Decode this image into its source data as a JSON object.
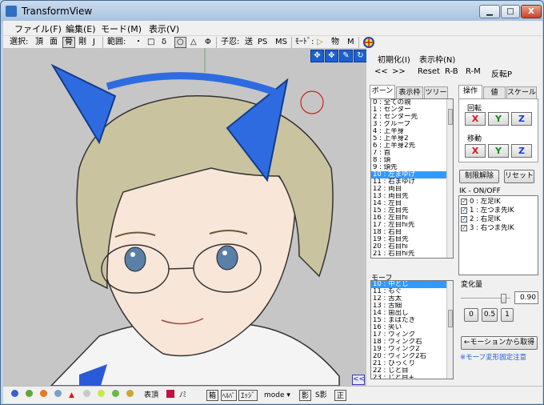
{
  "window": {
    "title": "TransformView",
    "min_label": "▁",
    "max_label": "□",
    "close_label": "X"
  },
  "menu": {
    "items": [
      "ファイル(F)",
      "編集(E)",
      "モード(M)",
      "表示(V)"
    ]
  },
  "toolbar": {
    "select_label": "選択:",
    "select_items": [
      "頂",
      "面",
      "骨",
      "剛",
      "J"
    ],
    "range_label": "範囲:",
    "range_items": [
      "・",
      "□",
      "δ",
      "○",
      "△",
      "Φ"
    ],
    "mode_label": "子忍:",
    "mode_items": [
      "送",
      "PS",
      "MS"
    ],
    "mode2_label": "ﾓｰﾄﾞ:",
    "play_icon": "▷",
    "physics_label": "物",
    "m_label": "M"
  },
  "viewport": {
    "tool_icons": [
      "move-icon",
      "move-icon",
      "pen-icon",
      "rotate-icon"
    ],
    "collapse_label": "<<"
  },
  "panel": {
    "top_links": [
      "初期化(I)",
      "表示枠(N)"
    ],
    "nav": [
      "<<",
      ">>",
      "Reset",
      "R-B",
      "R-M",
      "反転P"
    ],
    "bone_tabs": [
      "ボーン",
      "表示枠",
      "ツリー"
    ],
    "bone_list": [
      "0 : 全ての親",
      "1 : センター",
      "2 : センター先",
      "3 : グループ",
      "4 : 上半身",
      "5 : 上半身2",
      "6 : 上半身2先",
      "7 : 首",
      "8 : 頭",
      "9 : 頭先",
      "10 : 左まゆげ",
      "11 : 右まゆげ",
      "12 : 両目",
      "13 : 両目先",
      "14 : 左目",
      "15 : 左目先",
      "16 : 左目hi",
      "17 : 左目hi先",
      "18 : 右目",
      "19 : 右目先",
      "20 : 右目hi",
      "21 : 右目hi先"
    ],
    "bone_selected": 10,
    "op_tabs": [
      "操作",
      "値",
      "スケール"
    ],
    "rotate_label": "回転",
    "move_label": "移動",
    "axes": [
      "X",
      "Y",
      "Z"
    ],
    "axis_colors": {
      "X": "#d81818",
      "Y": "#0f8a1a",
      "Z": "#1a3fd8"
    },
    "release_button": "制限解除",
    "reset_button": "リセット",
    "ik_label": "IK - ON/OFF",
    "ik_items": [
      "0 : 左足IK",
      "1 : 左つま先IK",
      "2 : 右足IK",
      "3 : 右つま先IK"
    ],
    "morph_label": "モーフ",
    "morph_list": [
      "10 : 中とじ",
      "11 : もぐ",
      "12 : 舌太",
      "13 : 舌細",
      "14 : 歯出し",
      "15 : まばたき",
      "16 : 笑い",
      "17 : ウィンク",
      "18 : ウィンク右",
      "19 : ウィンク2",
      "20 : ウィンク2右",
      "21 : ひっくり",
      "22 : じと目",
      "23 : じと目+"
    ],
    "morph_selected": 0,
    "amount_label": "変化量",
    "amount_value": "0.90",
    "amount_fraction": 0.9,
    "preset_buttons": [
      "0",
      "0.5",
      "1"
    ],
    "from_motion_button": "←モーションから取得",
    "note": "※モーフ変形固定注意"
  },
  "statusbar": {
    "labels": [
      "表頂",
      "ﾉﾐ",
      "箱",
      "ﾍﾙﾊﾞ",
      "ｴｯｼﾞ",
      "mode ▾",
      "影",
      "S影",
      "正"
    ],
    "colors": [
      "#3a5fd0",
      "#5fa83a",
      "#e87820",
      "#7aa0c8",
      "#d81818",
      "#c8c8c8",
      "#c8e848",
      "#6ab84a",
      "#c8a830"
    ]
  }
}
